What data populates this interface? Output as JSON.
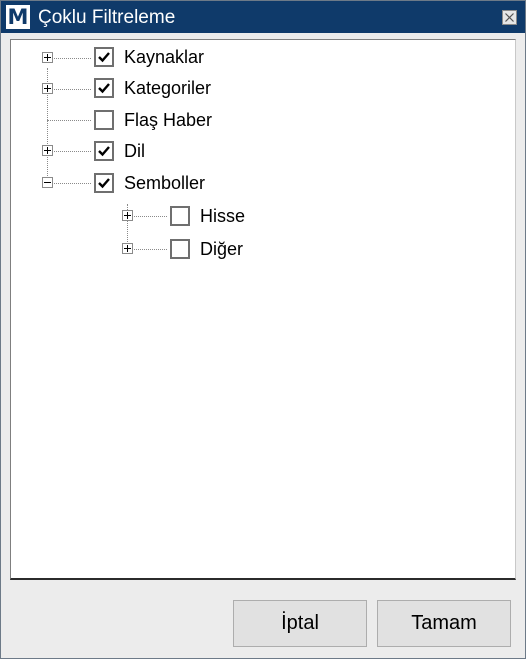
{
  "window": {
    "title": "Çoklu Filtreleme",
    "app_icon_letter": "M"
  },
  "tree": {
    "nodes": [
      {
        "label": "Kaynaklar",
        "checked": true,
        "expander": "plus"
      },
      {
        "label": "Kategoriler",
        "checked": true,
        "expander": "plus"
      },
      {
        "label": "Flaş Haber",
        "checked": false,
        "expander": "none"
      },
      {
        "label": "Dil",
        "checked": true,
        "expander": "plus"
      },
      {
        "label": "Semboller",
        "checked": true,
        "expander": "minus",
        "children": [
          {
            "label": "Hisse",
            "checked": false,
            "expander": "plus"
          },
          {
            "label": "Diğer",
            "checked": false,
            "expander": "plus"
          }
        ]
      }
    ]
  },
  "buttons": {
    "cancel_label": "İptal",
    "ok_label": "Tamam"
  },
  "colors": {
    "titlebar": "#0f3a6a",
    "tree_background": "#ffffff",
    "dialog_background": "#ececec"
  }
}
